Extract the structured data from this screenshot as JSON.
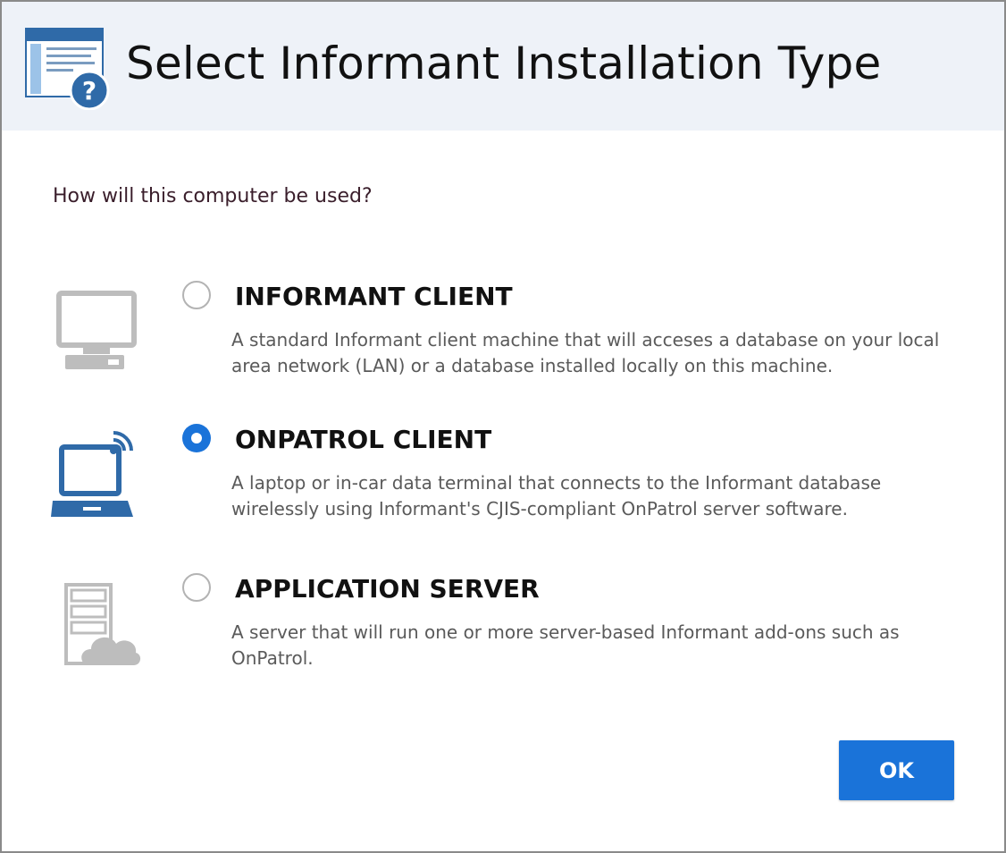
{
  "header": {
    "title": "Select Informant Installation Type",
    "icon": "window-help-icon"
  },
  "prompt": "How will this computer be used?",
  "options": [
    {
      "icon": "desktop-computer-icon",
      "title": "INFORMANT CLIENT",
      "description": "A standard Informant client machine that will acceses a database on your local area network (LAN) or a database installed locally on this machine.",
      "selected": false
    },
    {
      "icon": "laptop-wireless-icon",
      "title": "ONPATROL CLIENT",
      "description": "A laptop or in-car data terminal that connects to the Informant database wirelessly using Informant's CJIS-compliant OnPatrol server software.",
      "selected": true
    },
    {
      "icon": "server-cloud-icon",
      "title": "APPLICATION SERVER",
      "description": "A server that will run one or more server-based Informant add-ons such as OnPatrol.",
      "selected": false
    }
  ],
  "buttons": {
    "ok_label": "OK"
  },
  "colors": {
    "accent": "#1a73d9",
    "header_bg": "#eef2f8",
    "muted_icon": "#bdbdbd",
    "description_text": "#5a5a5a"
  }
}
